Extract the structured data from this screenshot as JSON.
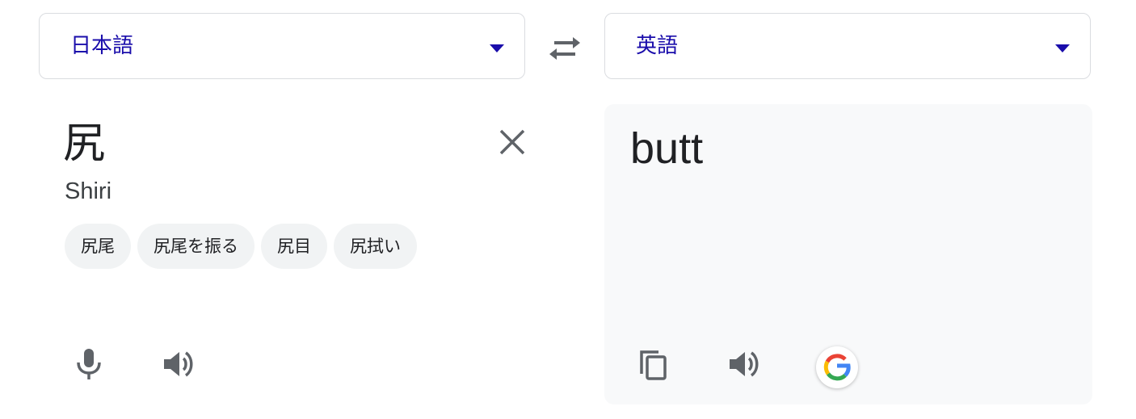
{
  "source_language": {
    "label": "日本語"
  },
  "target_language": {
    "label": "英語"
  },
  "source": {
    "text": "尻",
    "romanization": "Shiri",
    "suggestions": [
      "尻尾",
      "尻尾を振る",
      "尻目",
      "尻拭い"
    ]
  },
  "target": {
    "text": "butt"
  },
  "icons": {
    "swap": "swap-arrows-icon",
    "clear": "close-icon",
    "mic": "microphone-icon",
    "source_speaker": "speaker-icon",
    "copy": "copy-icon",
    "target_speaker": "speaker-icon",
    "google": "google-g-icon"
  },
  "colors": {
    "accent": "#1a0dab",
    "icon": "#5f6368",
    "panel": "#f8f9fa",
    "chip": "#f1f3f4",
    "google_blue": "#4285F4",
    "google_red": "#EA4335",
    "google_yellow": "#FBBC05",
    "google_green": "#34A853"
  }
}
